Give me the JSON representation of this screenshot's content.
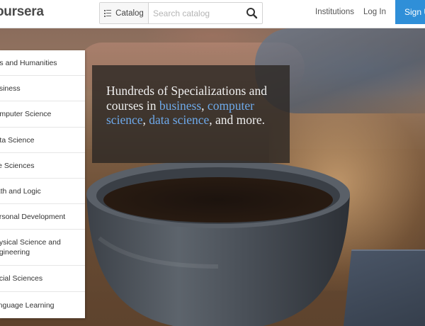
{
  "header": {
    "logo_text": "oursera",
    "catalog_label": "Catalog",
    "search_placeholder": "Search catalog",
    "nav": {
      "institutions": "Institutions",
      "login": "Log In",
      "signup": "Sign Up"
    }
  },
  "hero": {
    "tagline": {
      "prefix": "Hundreds of Specializations and courses in ",
      "link1": "business",
      "sep1": ", ",
      "link2": "computer science",
      "sep2": ", ",
      "link3": "data science",
      "suffix": ", and more."
    }
  },
  "categories": [
    "Arts and Humanities",
    "Business",
    "Computer Science",
    "Data Science",
    "Life Sciences",
    "Math and Logic",
    "Personal Development",
    "Physical Science and Engineering",
    "Social Sciences",
    "Language Learning"
  ],
  "colors": {
    "brand_blue": "#2f8fd8",
    "link_blue": "#6ea9ea"
  }
}
